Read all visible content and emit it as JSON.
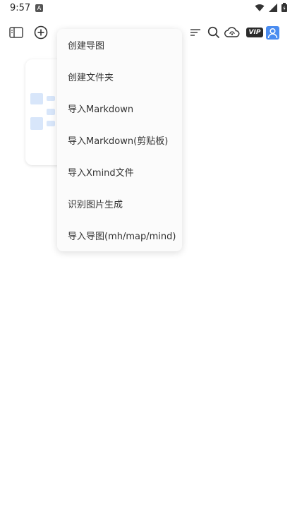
{
  "status_bar": {
    "time": "9:57",
    "notification_icon": "a-notification-icon",
    "wifi_icon": "wifi-icon",
    "signal_icon": "signal-icon",
    "battery_icon": "battery-icon"
  },
  "toolbar": {
    "sidebar_icon": "sidebar-icon",
    "add_icon": "add-icon",
    "sort_icon": "sort-icon",
    "search_icon": "search-icon",
    "cloud_icon": "cloud-sync-icon",
    "vip_label": "VIP",
    "avatar_icon": "user-avatar-icon",
    "accent_color": "#4a8cf0"
  },
  "menu": {
    "items": [
      {
        "label": "创建导图"
      },
      {
        "label": "创建文件夹"
      },
      {
        "label": "导入Markdown"
      },
      {
        "label": "导入Markdown(剪贴板)"
      },
      {
        "label": "导入Xmind文件"
      },
      {
        "label": "识别图片生成"
      },
      {
        "label": "导入导图(mh/map/mind)"
      }
    ]
  }
}
